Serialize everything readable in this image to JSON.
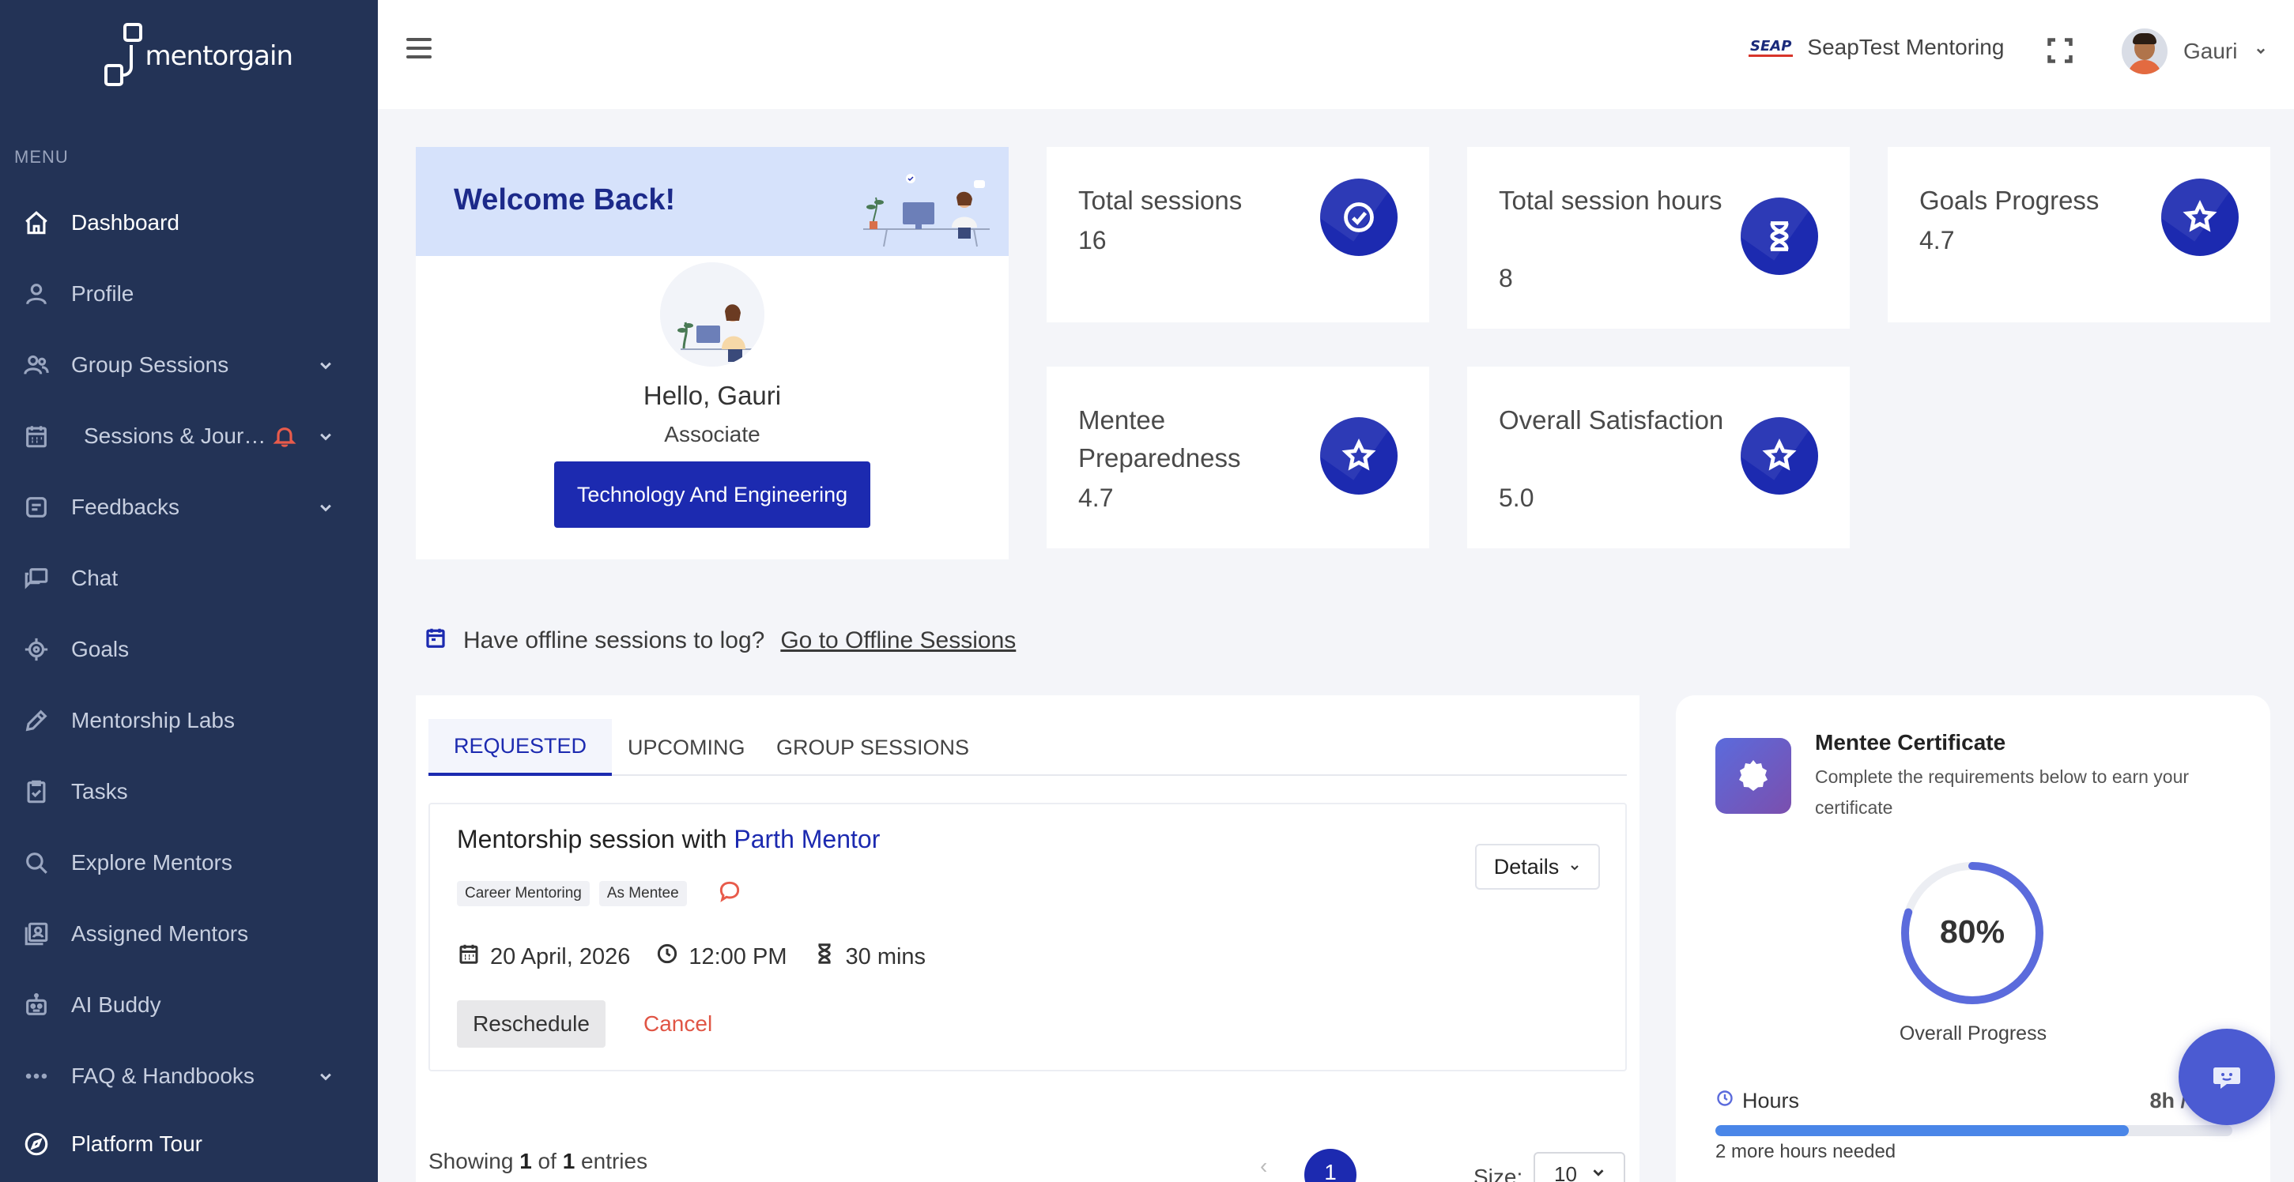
{
  "sidebar": {
    "logo_text": "mentorgain",
    "menu_label": "MENU",
    "items": [
      {
        "label": "Dashboard",
        "icon": "home-icon"
      },
      {
        "label": "Profile",
        "icon": "user-icon"
      },
      {
        "label": "Group Sessions",
        "icon": "group-icon"
      },
      {
        "label": "Sessions & Jour…",
        "icon": "calendar-icon"
      },
      {
        "label": "Feedbacks",
        "icon": "feedback-icon"
      },
      {
        "label": "Chat",
        "icon": "chat-icon"
      },
      {
        "label": "Goals",
        "icon": "target-icon"
      },
      {
        "label": "Mentorship Labs",
        "icon": "pencil-icon"
      },
      {
        "label": "Tasks",
        "icon": "clipboard-icon"
      },
      {
        "label": "Explore Mentors",
        "icon": "search-icon"
      },
      {
        "label": "Assigned Mentors",
        "icon": "contacts-icon"
      },
      {
        "label": "AI Buddy",
        "icon": "robot-icon"
      },
      {
        "label": "FAQ & Handbooks",
        "icon": "more-icon"
      },
      {
        "label": "Platform Tour",
        "icon": "compass-icon"
      }
    ]
  },
  "header": {
    "org_logo": "SEAP",
    "org_name": "SeapTest Mentoring",
    "user_name": "Gauri"
  },
  "welcome": {
    "title": "Welcome Back!",
    "hello": "Hello, Gauri",
    "role": "Associate",
    "department": "Technology And Engineering"
  },
  "stats": [
    {
      "label": "Total sessions",
      "value": "16",
      "icon": "check-circle-icon"
    },
    {
      "label": "Total session hours",
      "value": "8",
      "icon": "hourglass-icon"
    },
    {
      "label": "Goals Progress",
      "value": "4.7",
      "icon": "star-icon"
    },
    {
      "label": "Mentee Preparedness",
      "value": "4.7",
      "icon": "star-icon"
    },
    {
      "label": "Overall Satisfaction",
      "value": "5.0",
      "icon": "star-icon"
    }
  ],
  "offline": {
    "text": "Have offline sessions to log?",
    "link": "Go to Offline Sessions"
  },
  "sessions": {
    "tabs": [
      "REQUESTED",
      "UPCOMING",
      "GROUP SESSIONS"
    ],
    "active_tab": "REQUESTED",
    "card": {
      "title_prefix": "Mentorship session with",
      "mentor": "Parth Mentor",
      "tags": [
        "Career Mentoring",
        "As Mentee"
      ],
      "details_label": "Details",
      "date": "20 April, 2026",
      "time": "12:00 PM",
      "duration": "30 mins",
      "reschedule_label": "Reschedule",
      "cancel_label": "Cancel"
    },
    "showing_prefix": "Showing",
    "showing_from": "1",
    "showing_of": "of",
    "showing_total": "1",
    "showing_suffix": "entries",
    "pager_prev": "‹",
    "current_page": "1",
    "size_label": "Size:",
    "size_value": "10"
  },
  "certificate": {
    "title": "Mentee Certificate",
    "subtitle": "Complete the requirements below to earn your certificate",
    "progress_percent": 80,
    "progress_text": "80%",
    "progress_label": "Overall Progress",
    "hours_label": "Hours",
    "hours_value": "8h / 10h",
    "hours_fraction": 0.8,
    "hours_note": "2 more hours needed"
  },
  "colors": {
    "sidebar_bg": "#233356",
    "primary": "#1c2ab0",
    "accent_red": "#e85b4b",
    "progress_ring": "#5b6bdc"
  }
}
